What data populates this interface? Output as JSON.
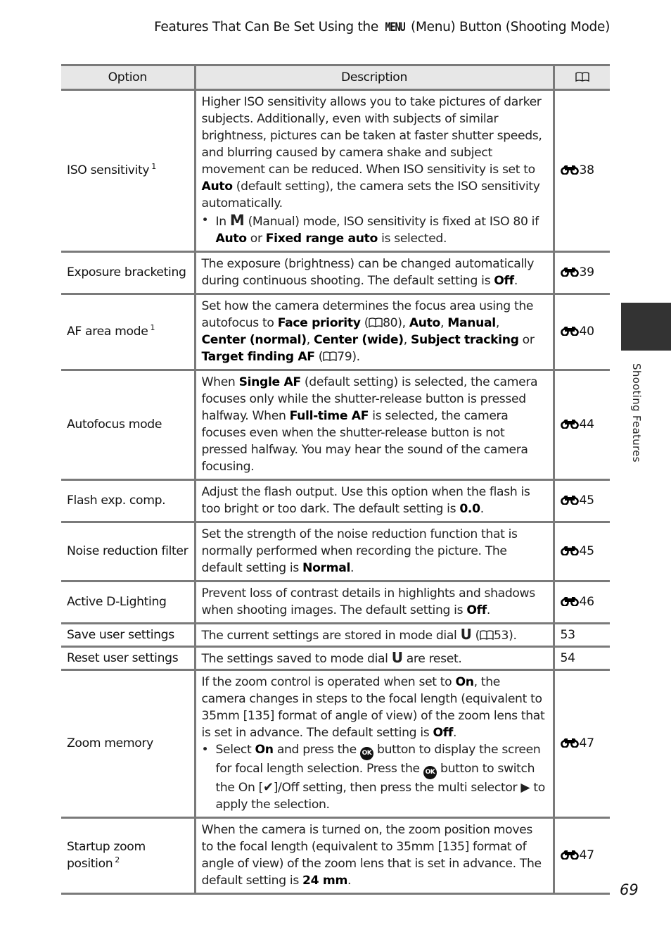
{
  "header": {
    "title_prefix": "Features That Can Be Set Using the ",
    "menu_glyph": "MENU",
    "title_suffix": " (Menu) Button (Shooting Mode)"
  },
  "table": {
    "columns": {
      "option": "Option",
      "description": "Description",
      "reference_icon": "book-icon"
    },
    "rows": [
      {
        "option": "ISO sensitivity",
        "footnote": "1",
        "desc": {
          "p1": "Higher ISO sensitivity allows you to take pictures of darker subjects. Additionally, even with subjects of similar brightness, pictures can be taken at faster shutter speeds, and blurring caused by camera shake and subject movement can be reduced. When ISO sensitivity is set to ",
          "b1": "Auto",
          "p2": " (default setting), the camera sets the ISO sensitivity automatically.",
          "bullet_a": "In ",
          "mode_glyph": "M",
          "bullet_b": " (Manual) mode, ISO sensitivity is fixed at ISO 80 if ",
          "bullet_b1": "Auto",
          "bullet_c": " or ",
          "bullet_b2": "Fixed range auto",
          "bullet_d": " is selected."
        },
        "ref": "38"
      },
      {
        "option": "Exposure bracketing",
        "desc": {
          "p1": "The exposure (brightness) can be changed automatically during continuous shooting. The default setting is ",
          "b1": "Off",
          "p2": "."
        },
        "ref": "39"
      },
      {
        "option": "AF area mode",
        "footnote": "1",
        "desc": {
          "p1": "Set how the camera determines the focus area using the autofocus to ",
          "b1": "Face priority",
          "r1": "80",
          "b2": "Auto",
          "b3": "Manual",
          "b4": "Center (normal)",
          "b5": "Center (wide)",
          "b6": "Subject tracking",
          "or": " or ",
          "b7": "Target finding AF",
          "r2": "79"
        },
        "ref": "40"
      },
      {
        "option": "Autofocus mode",
        "desc": {
          "p1": "When ",
          "b1": "Single AF",
          "p2": " (default setting) is selected, the camera focuses only while the shutter-release button is pressed halfway. When ",
          "b2": "Full-time AF",
          "p3": " is selected, the camera focuses even when the shutter-release button is not pressed halfway. You may hear the sound of the camera focusing."
        },
        "ref": "44"
      },
      {
        "option": "Flash exp. comp.",
        "desc": {
          "p1": "Adjust the flash output. Use this option when the flash is too bright or too dark. The default setting is ",
          "b1": "0.0",
          "p2": "."
        },
        "ref": "45"
      },
      {
        "option": "Noise reduction filter",
        "desc": {
          "p1": "Set the strength of the noise reduction function that is normally performed when recording the picture. The default setting is ",
          "b1": "Normal",
          "p2": "."
        },
        "ref": "45"
      },
      {
        "option": "Active D-Lighting",
        "desc": {
          "p1": "Prevent loss of contrast details in highlights and shadows when shooting images. The default setting is ",
          "b1": "Off",
          "p2": "."
        },
        "ref": "46"
      },
      {
        "option": "Save user settings",
        "desc": {
          "p1": "The current settings are stored in mode dial ",
          "dial_glyph": "U",
          "p2": " (",
          "r1": "53",
          "p3": ")."
        },
        "ref": "53"
      },
      {
        "option": "Reset user settings",
        "desc": {
          "p1": "The settings saved to mode dial ",
          "dial_glyph": "U",
          "p2": " are reset."
        },
        "ref": "54"
      },
      {
        "option": "Zoom memory",
        "desc": {
          "p1": "If the zoom control is operated when set to ",
          "b1": "On",
          "p2": ", the camera changes in steps to the focal length (equivalent to 35mm [135] format of angle of view) of the zoom lens that is set in advance. The default setting is ",
          "b2": "Off",
          "p3": ".",
          "bullet_a": "Select ",
          "bullet_b1": "On",
          "bullet_b": " and press the ",
          "ok_glyph": "OK",
          "bullet_c": " button to display the screen for focal length selection. Press the ",
          "bullet_d": " button to switch the On [",
          "bullet_e": "]/Off setting, then press the multi selector ",
          "arrow_glyph": "▶",
          "bullet_f": " to apply the selection."
        },
        "ref": "47"
      },
      {
        "option": "Startup zoom position",
        "footnote": "2",
        "desc": {
          "p1": "When the camera is turned on, the zoom position moves to the focal length (equivalent to 35mm [135] format of angle of view) of the zoom lens that is set in advance. The default setting is ",
          "b1": "24 mm",
          "p2": "."
        },
        "ref": "47"
      }
    ]
  },
  "side_tab": {
    "label": "Shooting Features",
    "color": "#333333"
  },
  "page_number": "69"
}
